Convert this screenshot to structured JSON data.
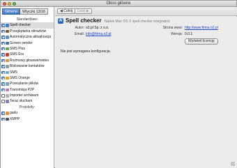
{
  "window": {
    "title": "Okno główne"
  },
  "left": {
    "tabs": [
      {
        "label": "Główna",
        "active": true
      },
      {
        "label": "Wtyczki 13/16",
        "active": false
      }
    ],
    "group_standard": "Standardowe:",
    "items": [
      {
        "label": "Spell checker",
        "checked": true,
        "selected": true,
        "icon_color": "#3a7bd5"
      },
      {
        "label": "Przeglądarka obrazków",
        "checked": true,
        "selected": false,
        "icon_color": "#7a5a2e"
      },
      {
        "label": "Automatyczna aktualizacja",
        "checked": true,
        "selected": false,
        "icon_color": "#5b8fd6"
      },
      {
        "label": "Screen sender",
        "checked": true,
        "selected": false,
        "icon_color": "#4d6fa0"
      },
      {
        "label": "SMS Plus",
        "checked": true,
        "selected": false,
        "icon_color": "#6aa84f"
      },
      {
        "label": "SMS Era",
        "checked": true,
        "selected": false,
        "icon_color": "#cc4125"
      },
      {
        "label": "Rozmowy głosowe/wideo",
        "checked": true,
        "selected": false,
        "icon_color": "#e69138"
      },
      {
        "label": "Blokowanie kontaktów",
        "checked": true,
        "selected": false,
        "icon_color": "#999999"
      },
      {
        "label": "SMS",
        "checked": true,
        "selected": false,
        "icon_color": "#6fa8dc"
      },
      {
        "label": "SMS Orange",
        "checked": true,
        "selected": false,
        "icon_color": "#f39c12"
      },
      {
        "label": "Przesyłanie plików",
        "checked": true,
        "selected": false,
        "icon_color": "#76a5af"
      },
      {
        "label": "Transmisja P2P",
        "checked": true,
        "selected": false,
        "icon_color": "#c27ba0"
      },
      {
        "label": "Importer archiwum",
        "checked": false,
        "selected": false,
        "icon_color": "#b0b0b0"
      },
      {
        "label": "Teraz słucham",
        "checked": false,
        "selected": false,
        "icon_color": "#8e7cc3"
      }
    ],
    "group_protocols": "Protokoły:",
    "protocols": [
      {
        "label": "gadu",
        "checked": true,
        "icon_color": "#e69138"
      },
      {
        "label": "XMPP",
        "checked": true,
        "icon_color": "#555555"
      }
    ]
  },
  "toolbar": {
    "back_label": "◀ Cofnij",
    "forward_label": "Dalej ▶"
  },
  "plugin": {
    "icon_glyph": "A",
    "name": "Spell checker",
    "description": "Native Mac OS X spell checker integration",
    "author_label": "Autor:",
    "author_value": "o2.pl Sp. z o.o.",
    "email_label": "Email:",
    "email_value": "info@firma.o2.pl",
    "homepage_label": "Strona www:",
    "homepage_value": "http://www.firma.o2.pl",
    "version_label": "Wersja:",
    "version_value": "0.0.1",
    "license_button": "Wyświetl licencję",
    "no_config_text": "Nie jest wymagana konfiguracja."
  }
}
